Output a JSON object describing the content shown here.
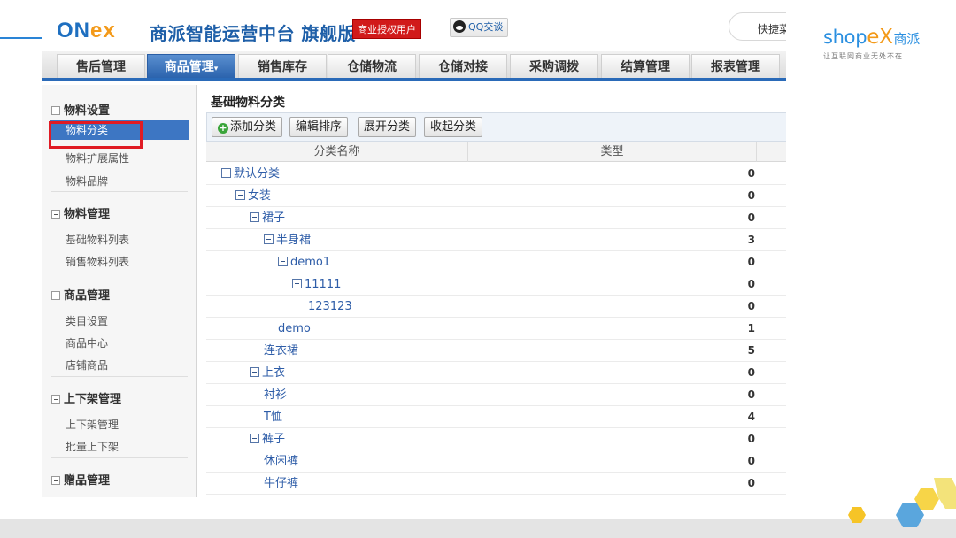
{
  "brand": {
    "logo_on": "ON",
    "logo_e": "e",
    "logo_x": "x",
    "title": "商派智能运营中台 旗舰版",
    "license": "商业授权用户",
    "qq": "QQ交谈",
    "shortcut": "快捷菜"
  },
  "shopex": {
    "logo_shop": "shop",
    "logo_ex": "eX",
    "logo_cn": "商派",
    "slogan": "让互联网商业无处不在"
  },
  "nav": [
    {
      "label": "售后管理",
      "active": false
    },
    {
      "label": "商品管理",
      "active": true,
      "caret": "▾"
    },
    {
      "label": "销售库存",
      "active": false
    },
    {
      "label": "仓储物流",
      "active": false
    },
    {
      "label": "仓储对接",
      "active": false
    },
    {
      "label": "采购调拨",
      "active": false
    },
    {
      "label": "结算管理",
      "active": false
    },
    {
      "label": "报表管理",
      "active": false
    }
  ],
  "sidebar": {
    "groups": [
      {
        "title": "物料设置",
        "items": [
          "物料分类",
          "物料扩展属性",
          "物料品牌"
        ]
      },
      {
        "title": "物料管理",
        "items": [
          "基础物料列表",
          "销售物料列表"
        ]
      },
      {
        "title": "商品管理",
        "items": [
          "类目设置",
          "商品中心",
          "店铺商品"
        ]
      },
      {
        "title": "上下架管理",
        "items": [
          "上下架管理",
          "批量上下架"
        ]
      },
      {
        "title": "赠品管理",
        "items": []
      }
    ],
    "active_item": "物料分类"
  },
  "main": {
    "title": "基础物料分类",
    "toolbar": {
      "add": "添加分类",
      "plus": "+",
      "sort": "编辑排序",
      "expand": "展开分类",
      "collapse": "收起分类"
    },
    "columns": {
      "name": "分类名称",
      "type": "类型"
    },
    "rows": [
      {
        "name": "默认分类",
        "type": "0",
        "level": 0,
        "expandable": true
      },
      {
        "name": "女装",
        "type": "0",
        "level": 1,
        "expandable": true
      },
      {
        "name": "裙子",
        "type": "0",
        "level": 2,
        "expandable": true
      },
      {
        "name": "半身裙",
        "type": "3",
        "level": 3,
        "expandable": true
      },
      {
        "name": "demo1",
        "type": "0",
        "level": 4,
        "expandable": true
      },
      {
        "name": "11111",
        "type": "0",
        "level": 5,
        "expandable": true
      },
      {
        "name": "123123",
        "type": "0",
        "level": 6,
        "expandable": false
      },
      {
        "name": "demo",
        "type": "1",
        "level": 4,
        "expandable": false
      },
      {
        "name": "连衣裙",
        "type": "5",
        "level": 3,
        "expandable": false
      },
      {
        "name": "上衣",
        "type": "0",
        "level": 2,
        "expandable": true
      },
      {
        "name": "衬衫",
        "type": "0",
        "level": 3,
        "expandable": false
      },
      {
        "name": "T恤",
        "type": "4",
        "level": 3,
        "expandable": false
      },
      {
        "name": "裤子",
        "type": "0",
        "level": 2,
        "expandable": true
      },
      {
        "name": "休闲裤",
        "type": "0",
        "level": 3,
        "expandable": false
      },
      {
        "name": "牛仔裤",
        "type": "0",
        "level": 3,
        "expandable": false
      }
    ]
  },
  "colors": {
    "accent": "#2a6ab8",
    "highlight": "#e01b24",
    "brand_blue": "#2a8fe0",
    "brand_orange": "#f39a1a"
  }
}
